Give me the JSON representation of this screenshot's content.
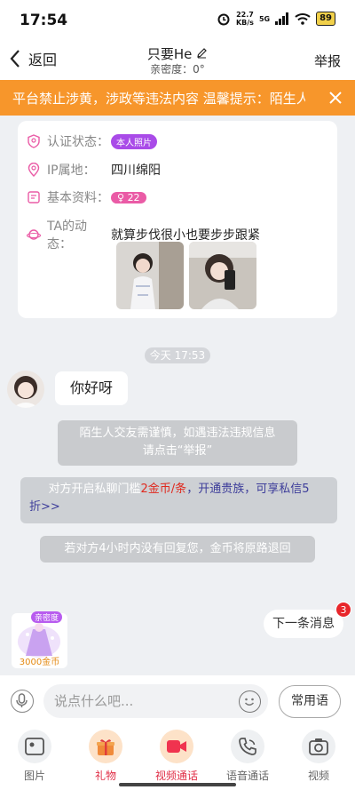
{
  "status_bar": {
    "time": "17:54",
    "speed_value": "22.7",
    "speed_unit": "KB/s",
    "network": "5G",
    "battery": "89"
  },
  "nav": {
    "back_label": "返回",
    "title": "只要He",
    "subtitle": "亲密度：0°",
    "report_label": "举报"
  },
  "banner": {
    "text": "平台禁止涉黄，涉政等违法内容 温馨提示：陌生人交友需谨慎"
  },
  "profile": {
    "auth_label": "认证状态：",
    "auth_badge": "本人照片",
    "ip_label": "IP属地：",
    "ip_value": "四川绵阳",
    "info_label": "基本资料：",
    "age": "22",
    "moment_label": "TA的动态：",
    "moment_text": "就算步伐很小也要步步跟紧"
  },
  "chat": {
    "time": "今天 17:53",
    "message": "你好呀",
    "notice_line1": "陌生人交友需谨慎，如遇违法违规信息",
    "notice_line2": "请点击“举报”",
    "fee_prefix": "对方开启私聊门槛",
    "fee_price": "2金币/条",
    "fee_sep": "，",
    "fee_link": "开通贵族，可享私信5",
    "fee_link2": "折>>",
    "refund": "若对方4小时内没有回复您，金币将原路退回"
  },
  "gift_float": {
    "tag": "亲密度",
    "coins": "3000金币"
  },
  "next_message": {
    "label": "下一条消息",
    "count": "3"
  },
  "input_bar": {
    "placeholder": "说点什么吧...",
    "phrases_label": "常用语"
  },
  "toolbar": {
    "picture": "图片",
    "gift": "礼物",
    "video_call": "视频通话",
    "voice_call": "语音通话",
    "video": "视频"
  },
  "colors": {
    "banner": "#f7962b",
    "price_red": "#e0291e",
    "link_blue": "#3d3d9a",
    "accent_pink": "#e02d46"
  }
}
